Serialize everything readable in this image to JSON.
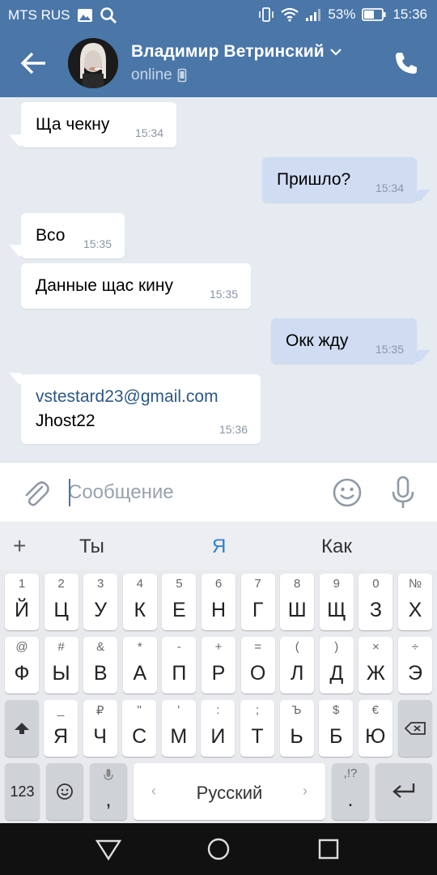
{
  "status_bar": {
    "carrier": "MTS RUS",
    "battery": "53%",
    "time": "15:36"
  },
  "header": {
    "contact_name": "Владимир Ветринский",
    "status": "online"
  },
  "messages": [
    {
      "direction": "in",
      "text": "Ща чекну",
      "time": "15:34"
    },
    {
      "direction": "out",
      "text": "Пришло?",
      "time": "15:34"
    },
    {
      "direction": "in",
      "text": "Всо",
      "time": "15:35"
    },
    {
      "direction": "in",
      "text": "Данные щас кину",
      "time": "15:35"
    },
    {
      "direction": "out",
      "text": "Окк жду",
      "time": "15:35"
    },
    {
      "direction": "in",
      "link": "vstestard23@gmail.com",
      "text": "Jhost22",
      "time": "15:36"
    }
  ],
  "composer": {
    "placeholder": "Сообщение"
  },
  "keyboard": {
    "suggestions": [
      "Ты",
      "Я",
      "Как"
    ],
    "row1": [
      [
        "1",
        "Й"
      ],
      [
        "2",
        "Ц"
      ],
      [
        "3",
        "У"
      ],
      [
        "4",
        "К"
      ],
      [
        "5",
        "Е"
      ],
      [
        "6",
        "Н"
      ],
      [
        "7",
        "Г"
      ],
      [
        "8",
        "Ш"
      ],
      [
        "9",
        "Щ"
      ],
      [
        "0",
        "З"
      ],
      [
        "№",
        "Х"
      ]
    ],
    "row2": [
      [
        "@",
        "Ф"
      ],
      [
        "#",
        "Ы"
      ],
      [
        "&",
        "В"
      ],
      [
        "*",
        "А"
      ],
      [
        "-",
        "П"
      ],
      [
        "+",
        "Р"
      ],
      [
        "=",
        "О"
      ],
      [
        "(",
        "Л"
      ],
      [
        ")",
        "Д"
      ],
      [
        "×",
        "Ж"
      ],
      [
        "÷",
        "Э"
      ]
    ],
    "row3": [
      [
        "_",
        "Я"
      ],
      [
        "₽",
        "Ч"
      ],
      [
        "\"",
        "С"
      ],
      [
        "'",
        "М"
      ],
      [
        ":",
        "И"
      ],
      [
        ";",
        "Т"
      ],
      [
        "Ъ",
        "Ь"
      ],
      [
        "$",
        "Б"
      ],
      [
        "€",
        "Ю"
      ]
    ],
    "numbers_key": "123",
    "comma_key": ",",
    "space_label": "Русский",
    "period_key": ".",
    "period_alt": ",!?"
  },
  "colors": {
    "header_bg": "#4a76a8",
    "chat_bg": "#e5ebf1",
    "outgoing_bubble": "#cfdcf2",
    "link": "#2a5885",
    "suggestion_active": "#2f7fd0"
  }
}
